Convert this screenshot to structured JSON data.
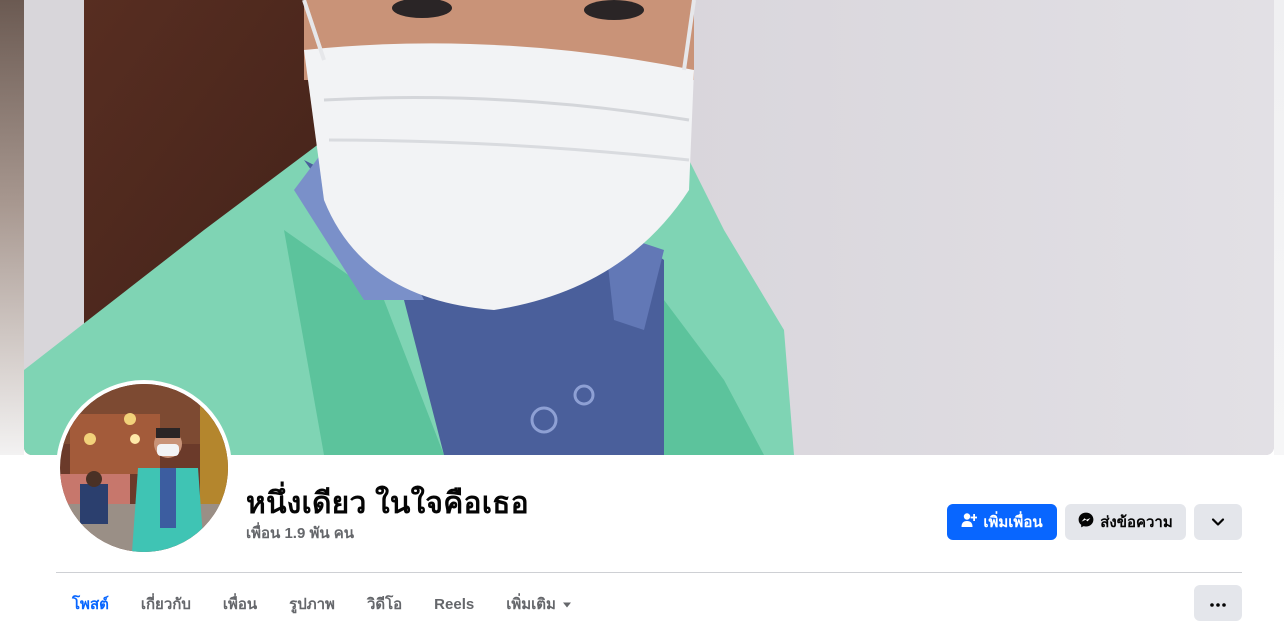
{
  "profile": {
    "name": "หนึ่งเดียว ในใจคือเธอ",
    "friends_count": "เพื่อน 1.9 พัน คน"
  },
  "actions": {
    "add_friend": "เพิ่มเพื่อน",
    "message": "ส่งข้อความ"
  },
  "tabs": [
    {
      "label": "โพสต์",
      "active": true
    },
    {
      "label": "เกี่ยวกับ",
      "active": false
    },
    {
      "label": "เพื่อน",
      "active": false
    },
    {
      "label": "รูปภาพ",
      "active": false
    },
    {
      "label": "วิดีโอ",
      "active": false
    },
    {
      "label": "Reels",
      "active": false
    },
    {
      "label": "เพิ่มเติม",
      "active": false
    }
  ],
  "colors": {
    "accent": "#0866ff",
    "secondary_button": "#e4e6eb",
    "text_primary": "#050505",
    "text_secondary": "#65676b"
  },
  "icons": [
    "person-add-icon",
    "messenger-icon",
    "chevron-down-icon",
    "caret-down-icon",
    "more-dots-icon"
  ]
}
